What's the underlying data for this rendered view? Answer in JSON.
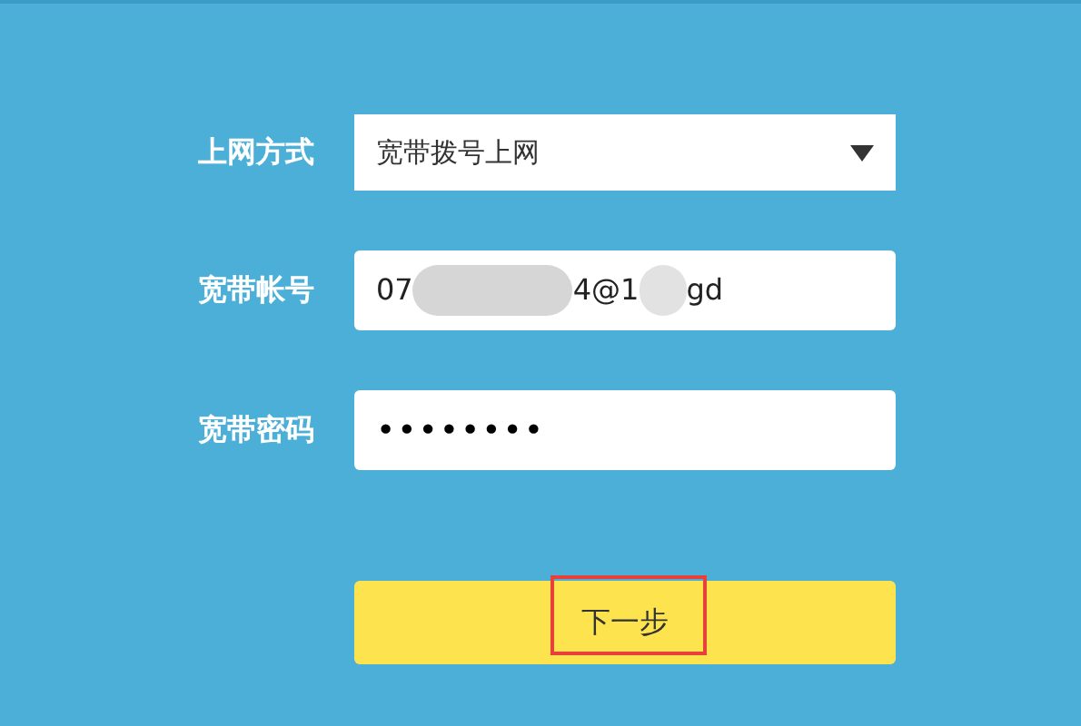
{
  "form": {
    "fields": [
      {
        "kind": "select",
        "label": "上网方式",
        "value": "宽带拨号上网"
      },
      {
        "kind": "redacted",
        "label": "宽带帐号",
        "value_parts": [
          "07",
          "4@1",
          "gd"
        ]
      },
      {
        "kind": "password",
        "label": "宽带密码",
        "value": "••••••••"
      }
    ],
    "next_button": {
      "label": "下一步",
      "highlighted": true
    }
  }
}
